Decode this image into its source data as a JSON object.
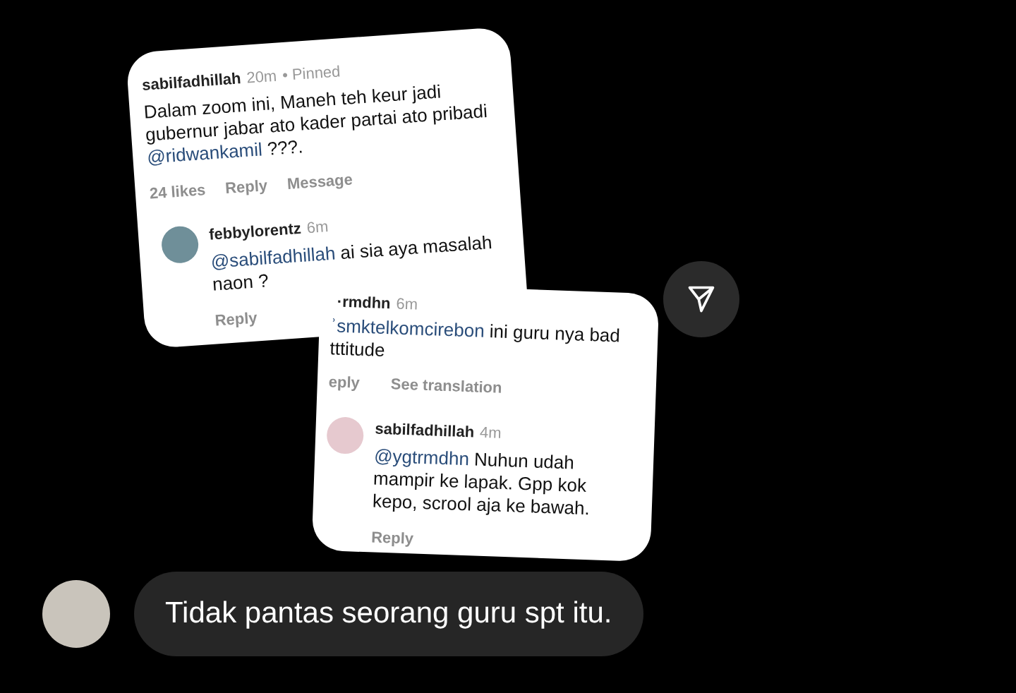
{
  "shared_image": {
    "cards": [
      {
        "comment": {
          "author": "sabilfadhillah",
          "time": "20m",
          "pinned": "• Pinned",
          "text": "Dalam zoom ini, Maneh teh keur jadi gubernur jabar ato kader partai ato pribadi",
          "mention": "@ridwankamil",
          "after": " ???.",
          "actions": [
            "24 likes",
            "Reply",
            "Message"
          ]
        },
        "reply": {
          "author": "febbylorentz",
          "time": "6m",
          "mention": "@sabilfadhillah",
          "text": " ai sia aya masalah naon ?",
          "actions": [
            "Reply"
          ]
        }
      },
      {
        "comment": {
          "author": "·rmdhn",
          "time": "6m",
          "mention": "ʾsmktelkomcirebon",
          "text": " ini guru nya bad tttitude",
          "actions": [
            "eply",
            "See translation"
          ]
        },
        "reply": {
          "author": "sabilfadhillah",
          "time": "4m",
          "mention": "@ygtrmdhn",
          "text": " Nuhun udah mampir ke lapak. Gpp kok kepo, scrool aja ke bawah.",
          "actions": [
            "Reply"
          ]
        }
      }
    ]
  },
  "message": {
    "text": "Tidak pantas seorang guru spt itu."
  }
}
